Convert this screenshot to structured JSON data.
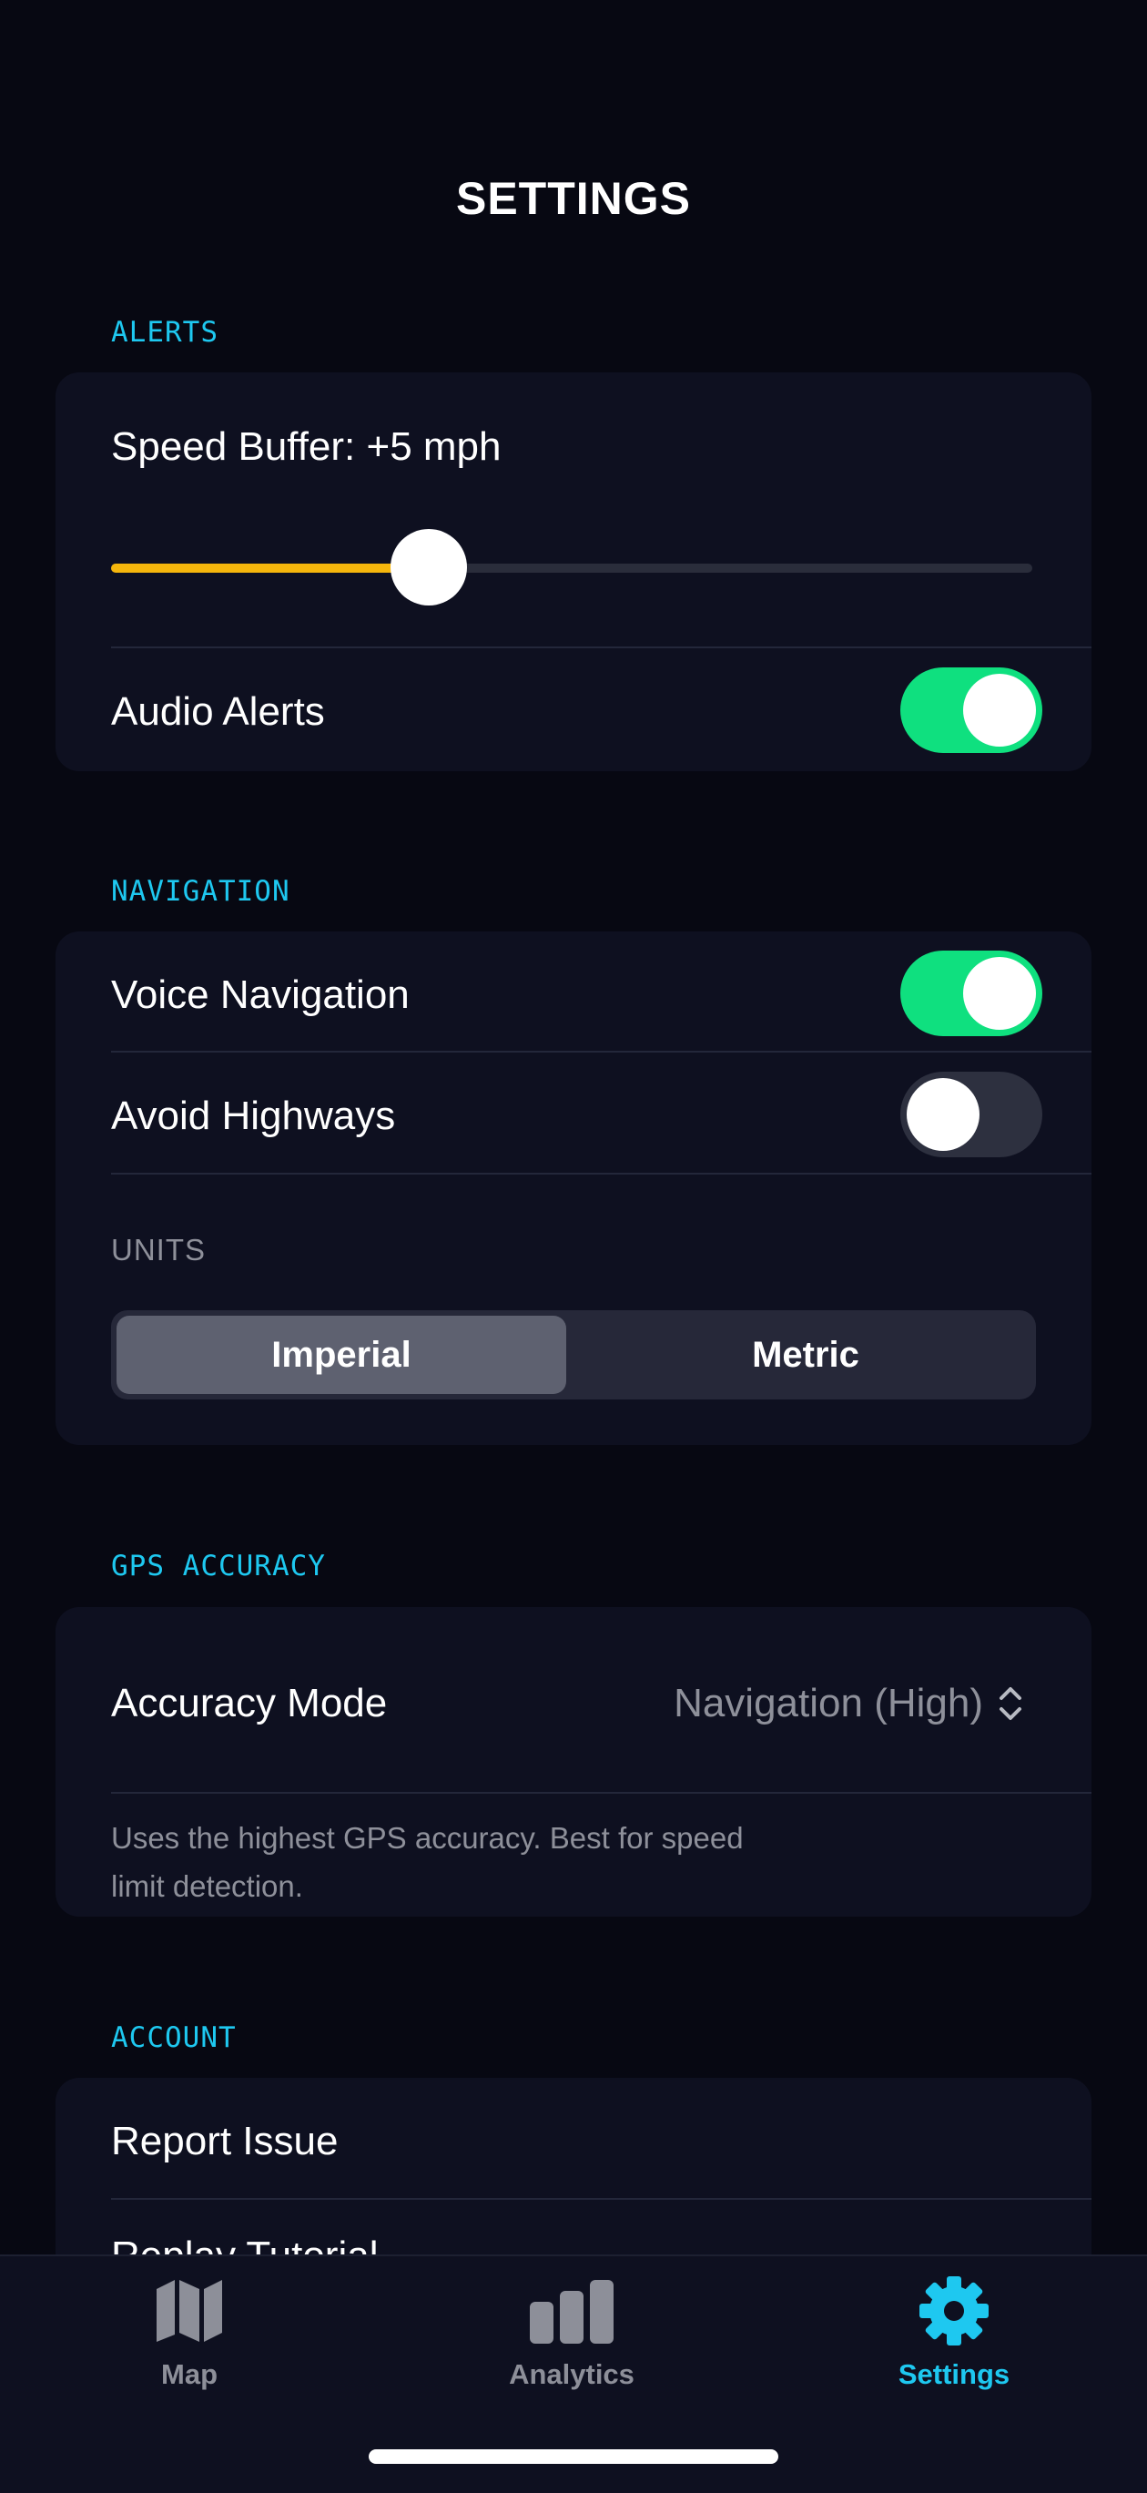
{
  "header": {
    "title": "SETTINGS"
  },
  "alerts": {
    "section_label": "ALERTS",
    "speed_buffer_label": "Speed Buffer: +5 mph",
    "speed_buffer_fraction": 0.345,
    "audio_alerts_label": "Audio Alerts",
    "audio_alerts_on": true
  },
  "navigation": {
    "section_label": "NAVIGATION",
    "voice_navigation_label": "Voice Navigation",
    "voice_navigation_on": true,
    "avoid_highways_label": "Avoid Highways",
    "avoid_highways_on": false,
    "units_label": "UNITS",
    "units_options": [
      "Imperial",
      "Metric"
    ],
    "units_selected": "Imperial"
  },
  "gps": {
    "section_label": "GPS ACCURACY",
    "accuracy_mode_label": "Accuracy Mode",
    "accuracy_mode_value": "Navigation (High)",
    "description_line1": "Uses the highest GPS accuracy. Best for speed",
    "description_line2": "limit detection."
  },
  "account": {
    "section_label": "ACCOUNT",
    "items": [
      "Report Issue",
      "Replay Tutorial"
    ]
  },
  "tabbar": {
    "tabs": [
      {
        "label": "Map",
        "icon": "map-icon",
        "active": false
      },
      {
        "label": "Analytics",
        "icon": "bar-chart-icon",
        "active": false
      },
      {
        "label": "Settings",
        "icon": "gear-icon",
        "active": true
      }
    ]
  },
  "colors": {
    "background": "#070812",
    "card": "#0e1020",
    "accent": "#1ec8f0",
    "toggle_on": "#0fe07f",
    "slider_fill": "#f5b60c",
    "inactive_tab": "#8d8f99"
  }
}
